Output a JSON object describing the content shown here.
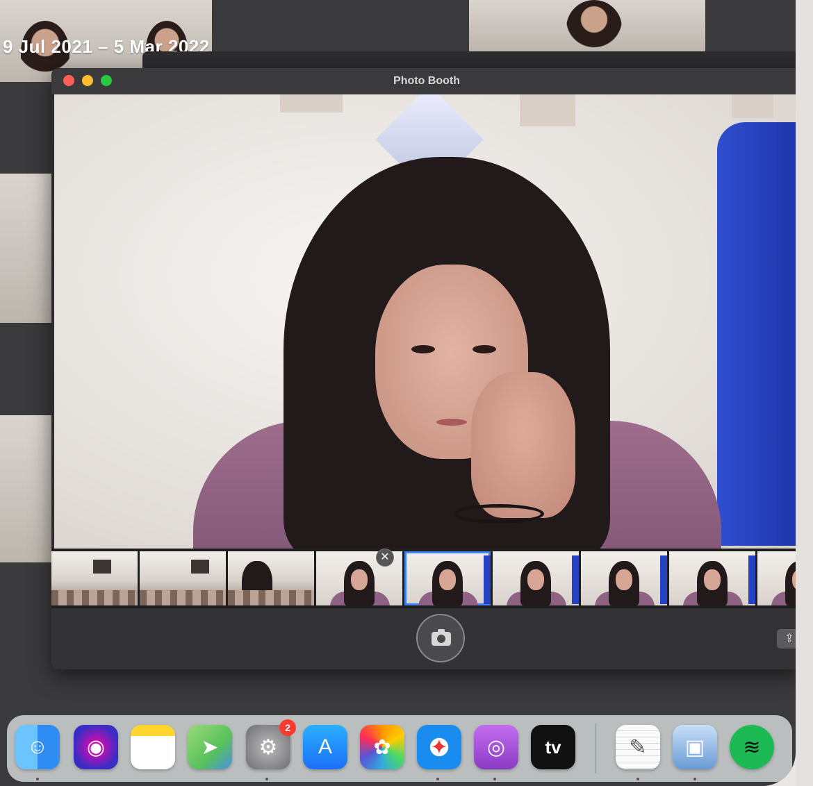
{
  "background": {
    "date_caption": "9 Jul 2021 – 5 Mar 2022"
  },
  "window": {
    "title": "Photo Booth",
    "controls": [
      "close",
      "minimize",
      "zoom"
    ]
  },
  "preview": {
    "description_icon": "camera-preview"
  },
  "thumbnails": {
    "count": 9,
    "selected_index": 4,
    "delete_glyph": "✕"
  },
  "toolbar": {
    "shutter_icon": "camera-icon",
    "share_glyph": "⇪"
  },
  "dock": {
    "apps": [
      {
        "name": "Finder",
        "icon": "finder-icon",
        "color": "#2f8cf2"
      },
      {
        "name": "Siri",
        "icon": "siri-icon",
        "color": "#5a3fd4"
      },
      {
        "name": "Notes",
        "icon": "notes-icon",
        "color": "#ffd52e"
      },
      {
        "name": "Maps",
        "icon": "maps-icon",
        "color": "#58c15a"
      },
      {
        "name": "System Preferences",
        "icon": "gear-icon",
        "color": "#8e8e93",
        "badge": "2"
      },
      {
        "name": "App Store",
        "icon": "app-store-icon",
        "color": "#1b8cf7"
      },
      {
        "name": "Photos",
        "icon": "photos-icon",
        "color": "#ffffff"
      },
      {
        "name": "Safari",
        "icon": "safari-icon",
        "color": "#1a8cf0"
      },
      {
        "name": "Podcasts",
        "icon": "podcasts-icon",
        "color": "#a452d6"
      },
      {
        "name": "TV",
        "icon": "tv-icon",
        "color": "#111111",
        "label": "tv"
      },
      {
        "name": "TextEdit",
        "icon": "textedit-icon",
        "color": "#f0f0f0"
      },
      {
        "name": "Preview",
        "icon": "preview-icon",
        "color": "#6a9bd6"
      },
      {
        "name": "Spotify",
        "icon": "spotify-icon",
        "color": "#1db954"
      }
    ]
  }
}
